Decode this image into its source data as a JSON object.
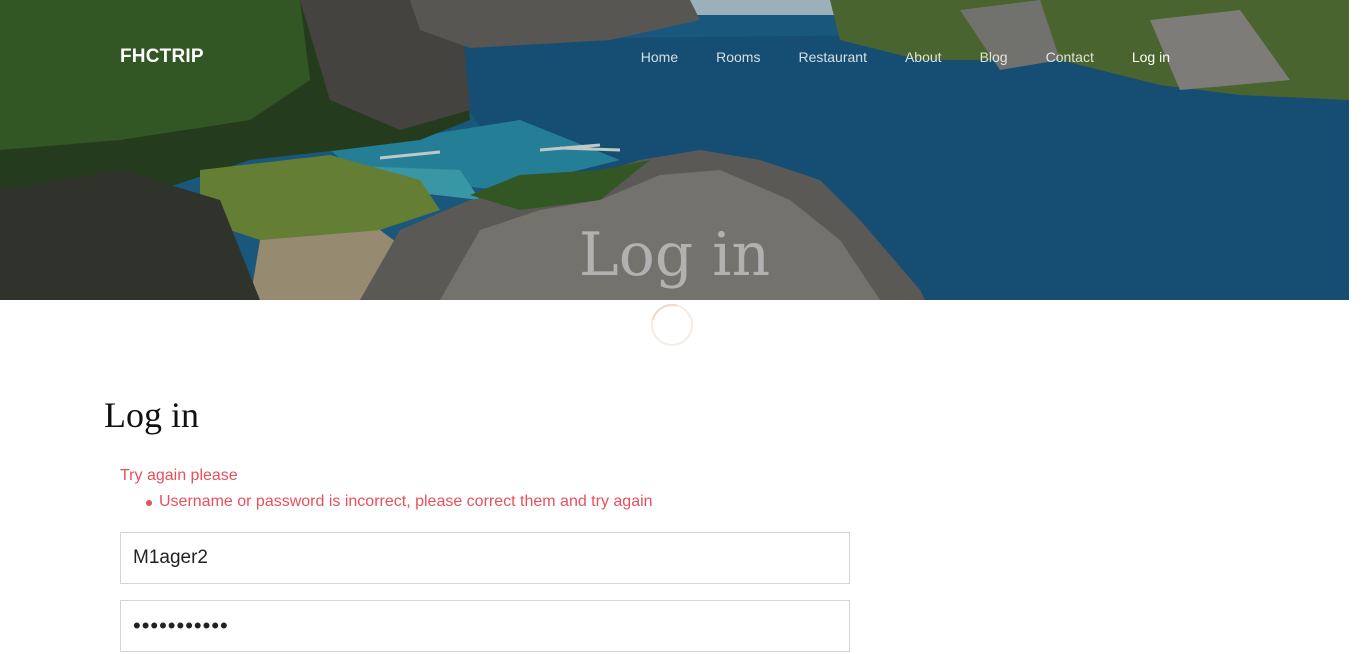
{
  "brand": {
    "name": "FHCTRIP"
  },
  "nav": {
    "items": [
      {
        "label": "Home"
      },
      {
        "label": "Rooms"
      },
      {
        "label": "Restaurant"
      },
      {
        "label": "About"
      },
      {
        "label": "Blog"
      },
      {
        "label": "Contact"
      },
      {
        "label": "Log in"
      }
    ],
    "active_color": "#ffffff"
  },
  "hero": {
    "title": "Log in"
  },
  "main": {
    "heading": "Log in",
    "error": {
      "title": "Try again please",
      "messages": [
        "Username or password is incorrect, please correct them and try again"
      ],
      "color": "#e8505b"
    },
    "form": {
      "username_value": "M1ager2",
      "password_value": "•••••••••••"
    }
  },
  "loader": {
    "icon": "spinner-icon"
  }
}
